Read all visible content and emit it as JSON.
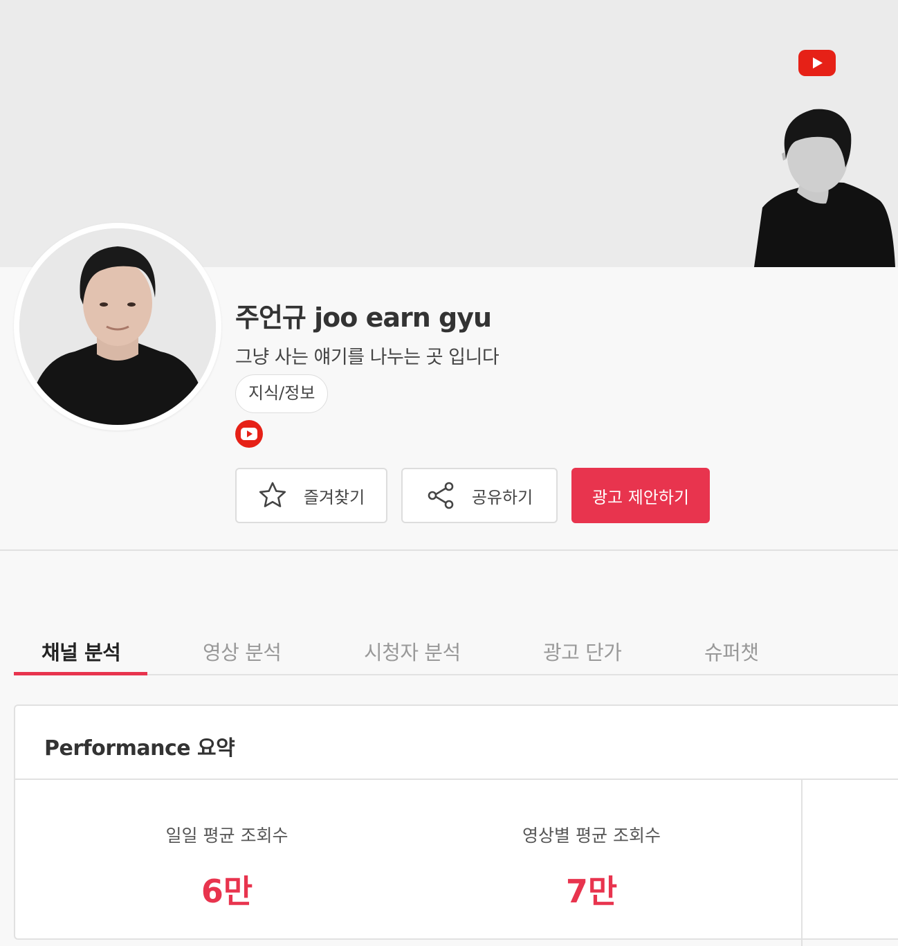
{
  "channel": {
    "name": "주언규 joo earn gyu",
    "description": "그냥 사는 얘기를 나누는 곳 입니다",
    "category": "지식/정보"
  },
  "actions": {
    "favorite_label": "즐겨찾기",
    "share_label": "공유하기",
    "ad_proposal_label": "광고 제안하기"
  },
  "tabs": [
    {
      "label": "채널 분석",
      "active": true
    },
    {
      "label": "영상 분석",
      "active": false
    },
    {
      "label": "시청자 분석",
      "active": false
    },
    {
      "label": "광고 단가",
      "active": false
    },
    {
      "label": "슈퍼챗",
      "active": false
    }
  ],
  "performance": {
    "title": "Performance 요약",
    "stats": [
      {
        "label": "일일 평균 조회수",
        "value": "6만"
      },
      {
        "label": "영상별 평균 조회수",
        "value": "7만"
      }
    ]
  },
  "colors": {
    "accent": "#e8344e",
    "youtube_red": "#e62117"
  }
}
